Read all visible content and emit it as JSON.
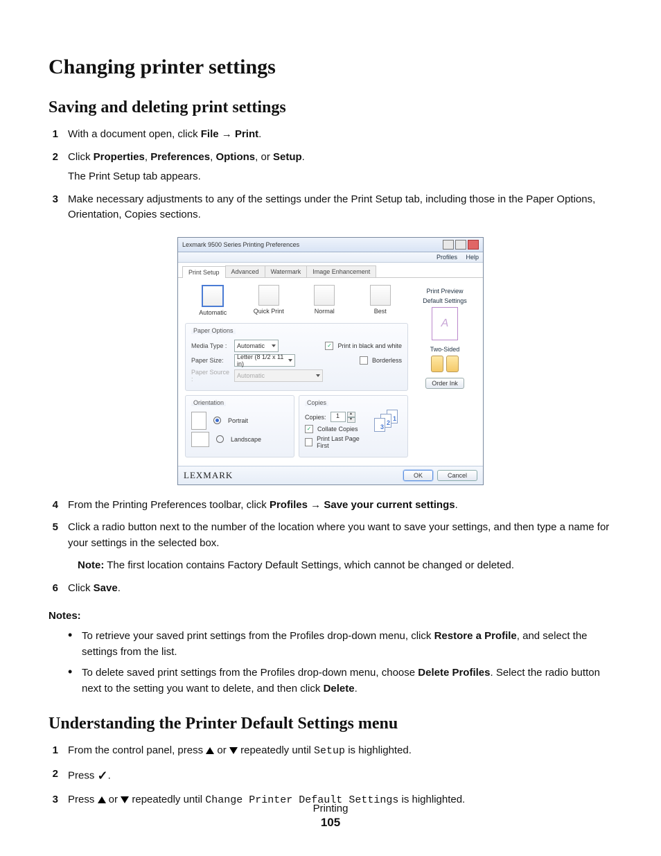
{
  "headings": {
    "h1": "Changing printer settings",
    "h2a": "Saving and deleting print settings",
    "h2b": "Understanding the Printer Default Settings menu"
  },
  "stepsA": {
    "n1": "1",
    "s1_pre": "With a document open, click ",
    "s1_b1": "File",
    "s1_arrow": " → ",
    "s1_b2": "Print",
    "s1_post": ".",
    "n2": "2",
    "s2_pre": "Click ",
    "s2_b1": "Properties",
    "s2_c1": ", ",
    "s2_b2": "Preferences",
    "s2_c2": ", ",
    "s2_b3": "Options",
    "s2_c3": ", or ",
    "s2_b4": "Setup",
    "s2_post": ".",
    "s2_sub": "The Print Setup tab appears.",
    "n3": "3",
    "s3": "Make necessary adjustments to any of the settings under the Print Setup tab, including those in the Paper Options, Orientation, Copies sections.",
    "n4": "4",
    "s4_pre": "From the Printing Preferences toolbar, click ",
    "s4_b1": "Profiles",
    "s4_arrow": " → ",
    "s4_b2": "Save your current settings",
    "s4_post": ".",
    "n5": "5",
    "s5": "Click a radio button next to the number of the location where you want to save your settings, and then type a name for your settings in the selected box.",
    "s5_note_label": "Note:",
    "s5_note": " The first location contains Factory Default Settings, which cannot be changed or deleted.",
    "n6": "6",
    "s6_pre": "Click ",
    "s6_b1": "Save",
    "s6_post": "."
  },
  "notes": {
    "head": "Notes:",
    "b1_pre": "To retrieve your saved print settings from the Profiles drop-down menu, click ",
    "b1_b": "Restore a Profile",
    "b1_post": ", and select the settings from the list.",
    "b2_pre": "To delete saved print settings from the Profiles drop-down menu, choose ",
    "b2_b1": "Delete Profiles",
    "b2_mid": ". Select the radio button next to the setting you want to delete, and then click ",
    "b2_b2": "Delete",
    "b2_post": "."
  },
  "stepsB": {
    "n1": "1",
    "s1_pre": "From the control panel, press ",
    "s1_or": " or ",
    "s1_mid": " repeatedly until ",
    "s1_mono": "Setup",
    "s1_post": " is highlighted.",
    "n2": "2",
    "s2_pre": "Press ",
    "s2_post": ".",
    "n3": "3",
    "s3_pre": "Press ",
    "s3_or": " or ",
    "s3_mid": " repeatedly until ",
    "s3_mono": "Change Printer Default Settings",
    "s3_post": " is highlighted."
  },
  "dialog": {
    "title": "Lexmark 9500 Series Printing Preferences",
    "toolbar": {
      "profiles": "Profiles",
      "help": "Help"
    },
    "tabs": {
      "t1": "Print Setup",
      "t2": "Advanced",
      "t3": "Watermark",
      "t4": "Image Enhancement"
    },
    "modes": {
      "m1": "Automatic",
      "m2": "Quick Print",
      "m3": "Normal",
      "m4": "Best"
    },
    "paper": {
      "legend": "Paper Options",
      "media_label": "Media Type :",
      "media_value": "Automatic",
      "size_label": "Paper Size:",
      "size_value": "Letter (8 1/2 x 11 in)",
      "source_label": "Paper Source :",
      "source_value": "Automatic",
      "bw": "Print in black and white",
      "borderless": "Borderless"
    },
    "orientation": {
      "legend": "Orientation",
      "portrait": "Portrait",
      "landscape": "Landscape"
    },
    "copies": {
      "legend": "Copies",
      "label": "Copies:",
      "value": "1",
      "collate": "Collate Copies",
      "lastfirst": "Print Last Page First"
    },
    "side": {
      "preview": "Print Preview",
      "defaults": "Default Settings",
      "twosided": "Two-Sided",
      "order": "Order Ink",
      "letter": "A"
    },
    "footer": {
      "brand": "LEXMARK",
      "ok": "OK",
      "cancel": "Cancel"
    }
  },
  "footer": {
    "section": "Printing",
    "page": "105"
  },
  "glyphs": {
    "check": "✓"
  }
}
